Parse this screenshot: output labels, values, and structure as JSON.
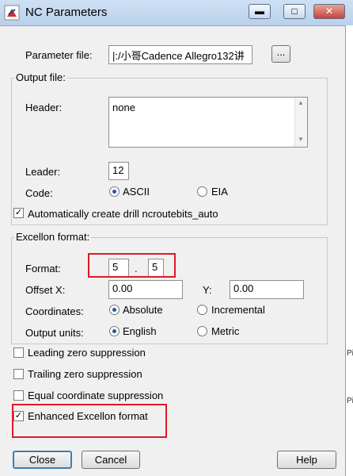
{
  "window": {
    "title": "NC Parameters",
    "min_icon": "minimize-icon",
    "max_icon": "maximize-icon",
    "close_icon": "close-icon"
  },
  "parameter_file": {
    "label": "Parameter file:",
    "value": "|:/小哥Cadence Allegro132讲",
    "browse_label": "..."
  },
  "output_file": {
    "group_label": "Output file:",
    "header_label": "Header:",
    "header_value": "none",
    "leader_label": "Leader:",
    "leader_value": "12",
    "code_label": "Code:",
    "code_options": [
      "ASCII",
      "EIA"
    ],
    "code_selected": "ASCII",
    "auto_create_label": "Automatically create drill ncroutebits_auto",
    "auto_create_checked": true
  },
  "excellon": {
    "group_label": "Excellon format:",
    "format_label": "Format:",
    "format_int": "5",
    "format_sep": ".",
    "format_dec": "5",
    "offset_x_label": "Offset X:",
    "offset_x_value": "0.00",
    "offset_y_label": "Y:",
    "offset_y_value": "0.00",
    "coordinates_label": "Coordinates:",
    "coordinates_options": [
      "Absolute",
      "Incremental"
    ],
    "coordinates_selected": "Absolute",
    "units_label": "Output units:",
    "units_options": [
      "English",
      "Metric"
    ],
    "units_selected": "English"
  },
  "options": {
    "leading_zero": {
      "label": "Leading zero suppression",
      "checked": false
    },
    "trailing_zero": {
      "label": "Trailing zero suppression",
      "checked": false
    },
    "equal_coord": {
      "label": "Equal coordinate suppression",
      "checked": false
    },
    "enhanced": {
      "label": "Enhanced Excellon format",
      "checked": true
    }
  },
  "buttons": {
    "close": "Close",
    "cancel": "Cancel",
    "help": "Help"
  },
  "background_strip": [
    "Pi",
    "Pi"
  ],
  "colors": {
    "highlight_box": "#e0182a",
    "radio_dot": "#2a55a6"
  }
}
